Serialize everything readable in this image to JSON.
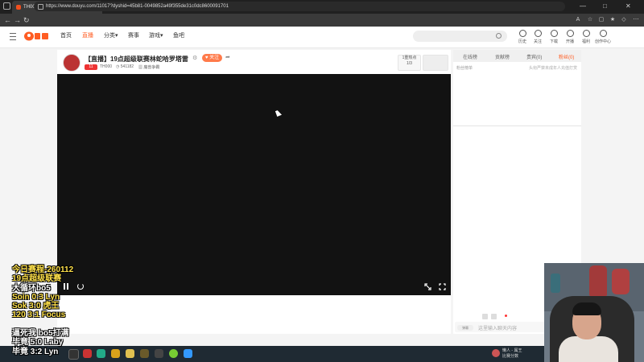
{
  "browser": {
    "tab_title": "TH000直播_TH000视频直播 - 斗鱼",
    "url": "https://www.douyu.com/11017?dyshid=45b81-0049852a49f355de31c0dc8600091701"
  },
  "header": {
    "nav": [
      {
        "label": "首页",
        "active": false
      },
      {
        "label": "直播",
        "active": true
      },
      {
        "label": "分类",
        "active": false
      },
      {
        "label": "赛事",
        "active": false
      },
      {
        "label": "游戏",
        "active": false
      },
      {
        "label": "鱼吧",
        "active": false
      }
    ],
    "icons": [
      {
        "label": "历史",
        "icon": "history-icon"
      },
      {
        "label": "关注",
        "icon": "heart-icon"
      },
      {
        "label": "下载",
        "icon": "download-icon"
      },
      {
        "label": "开播",
        "icon": "broadcast-icon"
      },
      {
        "label": "福利",
        "icon": "gift-icon"
      },
      {
        "label": "创作中心",
        "icon": "creator-icon"
      }
    ]
  },
  "room": {
    "title": "【直播】19点超级联赛林蛇哈罗塔雷",
    "follow_label": "关注",
    "badge": "11",
    "streamer": "TH000",
    "viewers": "541182",
    "category": "魔兽争霸",
    "hot_label": "1重热点",
    "hot_count": "1/3"
  },
  "right_panel": {
    "tabs": [
      "在线榜",
      "贡献榜",
      "贵宾(0)",
      "粉丝(0)"
    ],
    "active_tab": 3,
    "sub_left": "粉丝榜单",
    "sub_right": "头衔严禁未成年人充值打赏",
    "chat_button": "弹幕",
    "chat_placeholder": "这里输入聊天内容"
  },
  "overlay": {
    "lines": [
      {
        "text": "今日赛程-260112",
        "color": "yellow"
      },
      {
        "text": "19点超级联赛",
        "color": "yellow"
      },
      {
        "text": "大循环bo5",
        "color": "white"
      },
      {
        "text": "Soin 0:3 Lyn",
        "color": "yellow"
      },
      {
        "text": "Sok  3:0 虎王",
        "color": "yellow"
      },
      {
        "text": "120  3:1 Focus",
        "color": "yellow"
      },
      {
        "text": "",
        "color": "white"
      },
      {
        "text": "逼死我 bo5打满",
        "color": "white"
      },
      {
        "text": "毕竟 5:0 Laby",
        "color": "white"
      },
      {
        "text": "毕竟 3:2 Lyn",
        "color": "white"
      }
    ]
  },
  "taskbar": {
    "notification_title": "懒人 - 属王",
    "notification_sub": "比赛分数"
  },
  "colors": {
    "accent": "#ff5d23",
    "overlay_yellow": "#ffe14a"
  }
}
